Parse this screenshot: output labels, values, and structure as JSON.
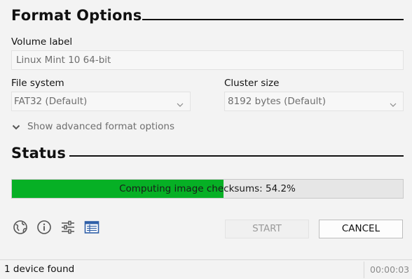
{
  "format_options": {
    "title": "Format Options",
    "volume_label": {
      "label": "Volume label",
      "value": "Linux Mint 10 64-bit"
    },
    "file_system": {
      "label": "File system",
      "value": "FAT32 (Default)"
    },
    "cluster_size": {
      "label": "Cluster size",
      "value": "8192 bytes (Default)"
    },
    "advanced_toggle": "Show advanced format options"
  },
  "status": {
    "title": "Status",
    "progress": {
      "text": "Computing image checksums: 54.2%",
      "percent": 54.2,
      "fill_color": "#06b025"
    }
  },
  "toolbar": {
    "icons": [
      "globe-icon",
      "info-icon",
      "settings-sliders-icon",
      "log-icon"
    ],
    "start_label": "START",
    "cancel_label": "CANCEL"
  },
  "statusbar": {
    "left_text": "1 device found",
    "timer": "00:00:03"
  }
}
